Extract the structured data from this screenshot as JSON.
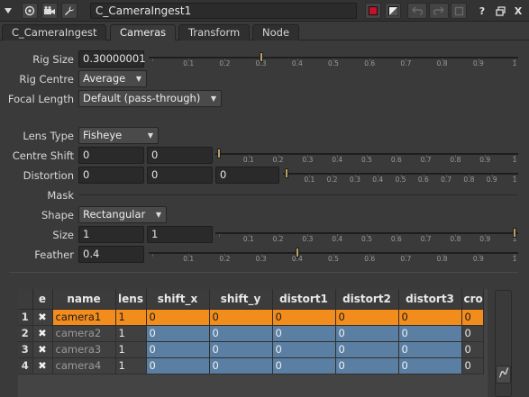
{
  "titlebar": {
    "node_name": "C_CameraIngest1",
    "icons_left": [
      "collapse-arrow-icon",
      "viewer-icon",
      "camera-icon",
      "wrench-icon"
    ],
    "icons_right": [
      "color-swatch-icon",
      "checker-icon",
      "undo-icon",
      "redo-icon",
      "revert-icon",
      "help-icon",
      "float-icon",
      "close-icon"
    ],
    "swatch_color": "#c8102e",
    "help_label": "?",
    "close_label": "X"
  },
  "tabs": [
    {
      "label": "C_CameraIngest",
      "active": false
    },
    {
      "label": "Cameras",
      "active": true
    },
    {
      "label": "Transform",
      "active": false
    },
    {
      "label": "Node",
      "active": false
    }
  ],
  "knobs": {
    "rig_size": {
      "label": "Rig Size",
      "value": "0.30000001",
      "slider_value": 0.3
    },
    "rig_centre": {
      "label": "Rig Centre",
      "value": "Average"
    },
    "focal_length": {
      "label": "Focal Length",
      "value": "Default (pass-through)"
    },
    "lens_type": {
      "label": "Lens Type",
      "value": "Fisheye"
    },
    "centre_shift": {
      "label": "Centre Shift",
      "x": "0",
      "y": "0",
      "slider_value": 0
    },
    "distortion": {
      "label": "Distortion",
      "a": "0",
      "b": "0",
      "c": "0",
      "slider_value": 0
    },
    "mask": {
      "label": "Mask"
    },
    "shape": {
      "label": "Shape",
      "value": "Rectangular"
    },
    "size": {
      "label": "Size",
      "x": "1",
      "y": "1",
      "slider_value": 1
    },
    "feather": {
      "label": "Feather",
      "value": "0.4",
      "slider_value": 0.4
    }
  },
  "slider_ticks": [
    "0",
    "0.1",
    "0.2",
    "0.3",
    "0.4",
    "0.5",
    "0.6",
    "0.7",
    "0.8",
    "0.9",
    "1"
  ],
  "table": {
    "headers": [
      "e",
      "name",
      "lens",
      "shift_x",
      "shift_y",
      "distort1",
      "distort2",
      "distort3",
      "cro"
    ],
    "rows": [
      {
        "num": "1",
        "e": "✖",
        "name": "camera1",
        "lens": "1",
        "shift_x": "0",
        "shift_y": "0",
        "distort1": "0",
        "distort2": "0",
        "distort3": "0",
        "cro": "0",
        "selected": true
      },
      {
        "num": "2",
        "e": "✖",
        "name": "camera2",
        "lens": "1",
        "shift_x": "0",
        "shift_y": "0",
        "distort1": "0",
        "distort2": "0",
        "distort3": "0",
        "cro": "0",
        "selected": false
      },
      {
        "num": "3",
        "e": "✖",
        "name": "camera3",
        "lens": "1",
        "shift_x": "0",
        "shift_y": "0",
        "distort1": "0",
        "distort2": "0",
        "distort3": "0",
        "cro": "0",
        "selected": false
      },
      {
        "num": "4",
        "e": "✖",
        "name": "camera4",
        "lens": "1",
        "shift_x": "0",
        "shift_y": "0",
        "distort1": "0",
        "distort2": "0",
        "distort3": "0",
        "cro": "0",
        "selected": false
      }
    ]
  },
  "colors": {
    "selected_row": "#f28c1c",
    "cell_blue": "#5b7fa3",
    "panel_bg": "#3a3a3a"
  }
}
